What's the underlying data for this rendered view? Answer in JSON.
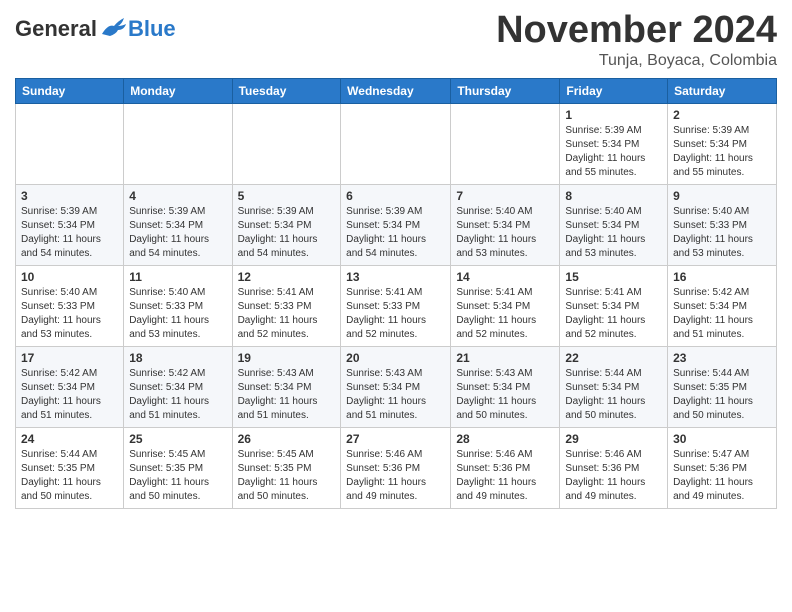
{
  "header": {
    "logo_general": "General",
    "logo_blue": "Blue",
    "month_title": "November 2024",
    "location": "Tunja, Boyaca, Colombia"
  },
  "days_of_week": [
    "Sunday",
    "Monday",
    "Tuesday",
    "Wednesday",
    "Thursday",
    "Friday",
    "Saturday"
  ],
  "weeks": [
    [
      {
        "day": "",
        "info": ""
      },
      {
        "day": "",
        "info": ""
      },
      {
        "day": "",
        "info": ""
      },
      {
        "day": "",
        "info": ""
      },
      {
        "day": "",
        "info": ""
      },
      {
        "day": "1",
        "info": "Sunrise: 5:39 AM\nSunset: 5:34 PM\nDaylight: 11 hours and 55 minutes."
      },
      {
        "day": "2",
        "info": "Sunrise: 5:39 AM\nSunset: 5:34 PM\nDaylight: 11 hours and 55 minutes."
      }
    ],
    [
      {
        "day": "3",
        "info": "Sunrise: 5:39 AM\nSunset: 5:34 PM\nDaylight: 11 hours and 54 minutes."
      },
      {
        "day": "4",
        "info": "Sunrise: 5:39 AM\nSunset: 5:34 PM\nDaylight: 11 hours and 54 minutes."
      },
      {
        "day": "5",
        "info": "Sunrise: 5:39 AM\nSunset: 5:34 PM\nDaylight: 11 hours and 54 minutes."
      },
      {
        "day": "6",
        "info": "Sunrise: 5:39 AM\nSunset: 5:34 PM\nDaylight: 11 hours and 54 minutes."
      },
      {
        "day": "7",
        "info": "Sunrise: 5:40 AM\nSunset: 5:34 PM\nDaylight: 11 hours and 53 minutes."
      },
      {
        "day": "8",
        "info": "Sunrise: 5:40 AM\nSunset: 5:34 PM\nDaylight: 11 hours and 53 minutes."
      },
      {
        "day": "9",
        "info": "Sunrise: 5:40 AM\nSunset: 5:33 PM\nDaylight: 11 hours and 53 minutes."
      }
    ],
    [
      {
        "day": "10",
        "info": "Sunrise: 5:40 AM\nSunset: 5:33 PM\nDaylight: 11 hours and 53 minutes."
      },
      {
        "day": "11",
        "info": "Sunrise: 5:40 AM\nSunset: 5:33 PM\nDaylight: 11 hours and 53 minutes."
      },
      {
        "day": "12",
        "info": "Sunrise: 5:41 AM\nSunset: 5:33 PM\nDaylight: 11 hours and 52 minutes."
      },
      {
        "day": "13",
        "info": "Sunrise: 5:41 AM\nSunset: 5:33 PM\nDaylight: 11 hours and 52 minutes."
      },
      {
        "day": "14",
        "info": "Sunrise: 5:41 AM\nSunset: 5:34 PM\nDaylight: 11 hours and 52 minutes."
      },
      {
        "day": "15",
        "info": "Sunrise: 5:41 AM\nSunset: 5:34 PM\nDaylight: 11 hours and 52 minutes."
      },
      {
        "day": "16",
        "info": "Sunrise: 5:42 AM\nSunset: 5:34 PM\nDaylight: 11 hours and 51 minutes."
      }
    ],
    [
      {
        "day": "17",
        "info": "Sunrise: 5:42 AM\nSunset: 5:34 PM\nDaylight: 11 hours and 51 minutes."
      },
      {
        "day": "18",
        "info": "Sunrise: 5:42 AM\nSunset: 5:34 PM\nDaylight: 11 hours and 51 minutes."
      },
      {
        "day": "19",
        "info": "Sunrise: 5:43 AM\nSunset: 5:34 PM\nDaylight: 11 hours and 51 minutes."
      },
      {
        "day": "20",
        "info": "Sunrise: 5:43 AM\nSunset: 5:34 PM\nDaylight: 11 hours and 51 minutes."
      },
      {
        "day": "21",
        "info": "Sunrise: 5:43 AM\nSunset: 5:34 PM\nDaylight: 11 hours and 50 minutes."
      },
      {
        "day": "22",
        "info": "Sunrise: 5:44 AM\nSunset: 5:34 PM\nDaylight: 11 hours and 50 minutes."
      },
      {
        "day": "23",
        "info": "Sunrise: 5:44 AM\nSunset: 5:35 PM\nDaylight: 11 hours and 50 minutes."
      }
    ],
    [
      {
        "day": "24",
        "info": "Sunrise: 5:44 AM\nSunset: 5:35 PM\nDaylight: 11 hours and 50 minutes."
      },
      {
        "day": "25",
        "info": "Sunrise: 5:45 AM\nSunset: 5:35 PM\nDaylight: 11 hours and 50 minutes."
      },
      {
        "day": "26",
        "info": "Sunrise: 5:45 AM\nSunset: 5:35 PM\nDaylight: 11 hours and 50 minutes."
      },
      {
        "day": "27",
        "info": "Sunrise: 5:46 AM\nSunset: 5:36 PM\nDaylight: 11 hours and 49 minutes."
      },
      {
        "day": "28",
        "info": "Sunrise: 5:46 AM\nSunset: 5:36 PM\nDaylight: 11 hours and 49 minutes."
      },
      {
        "day": "29",
        "info": "Sunrise: 5:46 AM\nSunset: 5:36 PM\nDaylight: 11 hours and 49 minutes."
      },
      {
        "day": "30",
        "info": "Sunrise: 5:47 AM\nSunset: 5:36 PM\nDaylight: 11 hours and 49 minutes."
      }
    ]
  ]
}
